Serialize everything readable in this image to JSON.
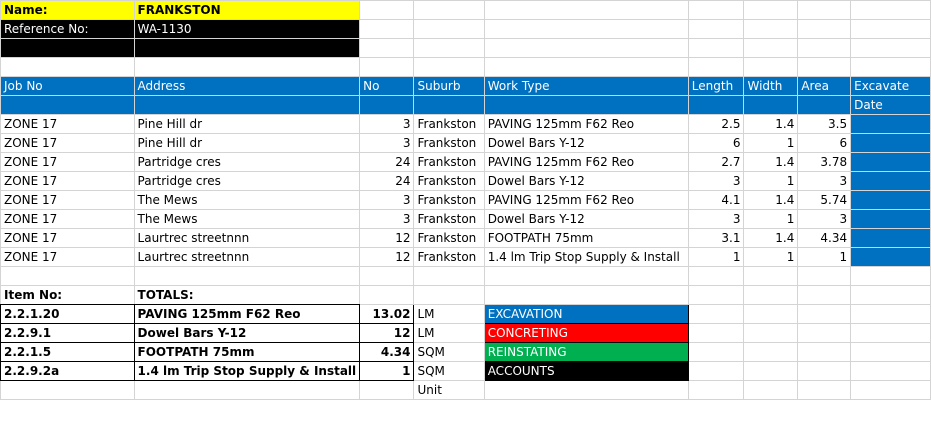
{
  "header": {
    "name_label": "Name:",
    "name_value": "FRANKSTON",
    "ref_label": "Reference No:",
    "ref_value": "WA-1130"
  },
  "columns": {
    "job_no": "Job No",
    "address": "Address",
    "no": "No",
    "suburb": "Suburb",
    "work_type": "Work Type",
    "length": "Length",
    "width": "Width",
    "area": "Area",
    "excavate": "Excavate",
    "excavate_sub": "Date"
  },
  "rows": [
    {
      "job": "ZONE 17",
      "address": "Pine Hill dr",
      "no": "3",
      "suburb": "Frankston",
      "work": "PAVING 125mm F62 Reo",
      "length": "2.5",
      "width": "1.4",
      "area": "3.5"
    },
    {
      "job": "ZONE 17",
      "address": "Pine Hill dr",
      "no": "3",
      "suburb": "Frankston",
      "work": "Dowel Bars Y-12",
      "length": "6",
      "width": "1",
      "area": "6"
    },
    {
      "job": "ZONE 17",
      "address": "Partridge cres",
      "no": "24",
      "suburb": "Frankston",
      "work": "PAVING 125mm F62 Reo",
      "length": "2.7",
      "width": "1.4",
      "area": "3.78"
    },
    {
      "job": "ZONE 17",
      "address": "Partridge cres",
      "no": "24",
      "suburb": "Frankston",
      "work": "Dowel Bars Y-12",
      "length": "3",
      "width": "1",
      "area": "3"
    },
    {
      "job": "ZONE 17",
      "address": "The Mews",
      "no": "3",
      "suburb": "Frankston",
      "work": "PAVING 125mm F62 Reo",
      "length": "4.1",
      "width": "1.4",
      "area": "5.74"
    },
    {
      "job": "ZONE 17",
      "address": "The Mews",
      "no": "3",
      "suburb": "Frankston",
      "work": "Dowel Bars Y-12",
      "length": "3",
      "width": "1",
      "area": "3"
    },
    {
      "job": "ZONE 17",
      "address": "Laurtrec streetnnn",
      "no": "12",
      "suburb": "Frankston",
      "work": "FOOTPATH 75mm",
      "length": "3.1",
      "width": "1.4",
      "area": "4.34"
    },
    {
      "job": "ZONE 17",
      "address": "Laurtrec streetnnn",
      "no": "12",
      "suburb": "Frankston",
      "work": "1.4 lm Trip Stop Supply & Install",
      "length": "1",
      "width": "1",
      "area": "1"
    }
  ],
  "totals": {
    "item_label": "Item No:",
    "totals_label": "TOTALS:",
    "unit_label": "Unit",
    "items": [
      {
        "item": "2.2.1.20",
        "desc": "PAVING 125mm F62 Reo",
        "qty": "13.02",
        "unit": "LM"
      },
      {
        "item": "2.2.9.1",
        "desc": "Dowel Bars Y-12",
        "qty": "12",
        "unit": "LM"
      },
      {
        "item": "2.2.1.5",
        "desc": "FOOTPATH 75mm",
        "qty": "4.34",
        "unit": "SQM"
      },
      {
        "item": "2.2.9.2a",
        "desc": "1.4 lm Trip Stop Supply & Install",
        "qty": "1",
        "unit": "SQM"
      }
    ]
  },
  "legend": [
    {
      "label": "EXCAVATION",
      "color": "#0070c0"
    },
    {
      "label": "CONCRETING",
      "color": "#ff0000"
    },
    {
      "label": "REINSTATING",
      "color": "#00b050"
    },
    {
      "label": "ACCOUNTS",
      "color": "#000000"
    }
  ]
}
